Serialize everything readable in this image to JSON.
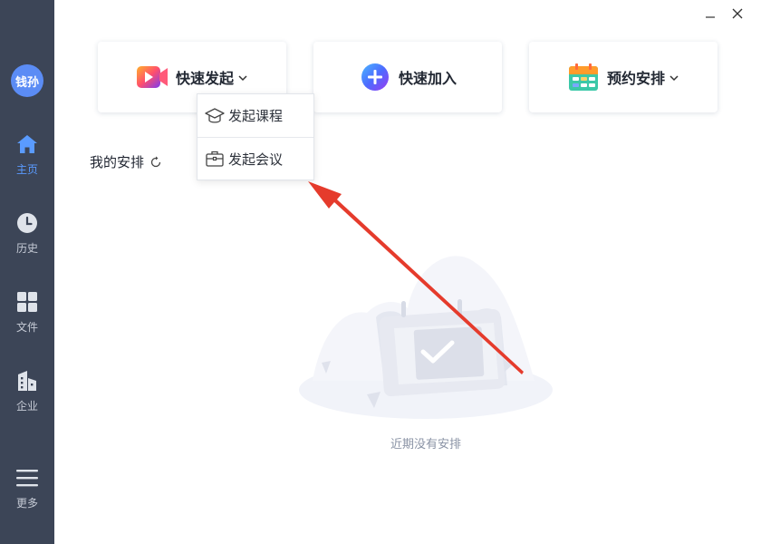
{
  "user": {
    "avatar_text": "钱孙"
  },
  "sidebar": {
    "items": [
      {
        "label": "主页",
        "icon": "home-icon",
        "active": true
      },
      {
        "label": "历史",
        "icon": "clock-icon"
      },
      {
        "label": "文件",
        "icon": "grid-icon"
      },
      {
        "label": "企业",
        "icon": "building-icon"
      },
      {
        "label": "更多",
        "icon": "menu-icon"
      }
    ]
  },
  "actions": {
    "start": {
      "label": "快速发起",
      "icon": "play-video-icon"
    },
    "join": {
      "label": "快速加入",
      "icon": "plus-circle-icon"
    },
    "schedule": {
      "label": "预约安排",
      "icon": "calendar-icon"
    }
  },
  "dropdown": {
    "items": [
      {
        "label": "发起课程",
        "icon": "graduation-cap-icon"
      },
      {
        "label": "发起会议",
        "icon": "briefcase-icon"
      }
    ]
  },
  "main": {
    "section_title": "我的安排",
    "empty_text": "近期没有安排"
  },
  "colors": {
    "sidebar_bg": "#3c4557",
    "accent": "#5a9bff",
    "annotation_arrow": "#e53b2c"
  }
}
